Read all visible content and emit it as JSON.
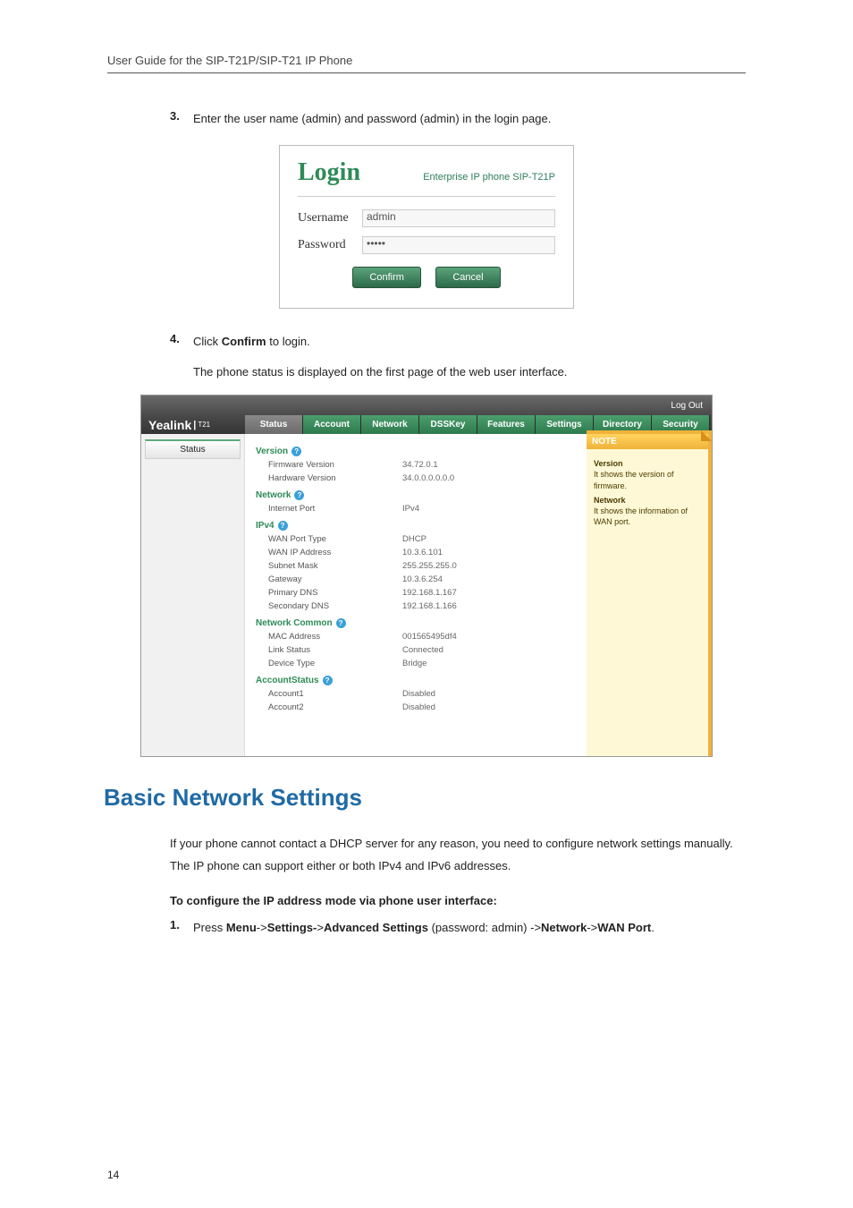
{
  "guide_title": "User Guide for the SIP-T21P/SIP-T21 IP Phone",
  "step3": {
    "num": "3.",
    "text": "Enter the user name (admin) and password (admin) in the login page."
  },
  "login": {
    "title": "Login",
    "subtitle": "Enterprise IP phone SIP-T21P",
    "username_label": "Username",
    "username_value": "admin",
    "password_label": "Password",
    "password_value": "•••••",
    "confirm": "Confirm",
    "cancel": "Cancel"
  },
  "step4": {
    "num": "4.",
    "prefix": "Click ",
    "bold": "Confirm",
    "suffix": " to login."
  },
  "step4_sub": "The phone status is displayed on the first page of the web user interface.",
  "webui": {
    "logout": "Log Out",
    "logo": "Yealink",
    "logo_sub": "T21",
    "tabs": [
      "Status",
      "Account",
      "Network",
      "DSSKey",
      "Features",
      "Settings",
      "Directory",
      "Security"
    ],
    "side": "Status",
    "sections": {
      "version": {
        "title": "Version",
        "rows": [
          {
            "k": "Firmware Version",
            "v": "34.72.0.1"
          },
          {
            "k": "Hardware Version",
            "v": "34.0.0.0.0.0.0"
          }
        ]
      },
      "network": {
        "title": "Network",
        "rows": [
          {
            "k": "Internet Port",
            "v": "IPv4"
          }
        ]
      },
      "ipv4": {
        "title": "IPv4",
        "rows": [
          {
            "k": "WAN Port Type",
            "v": "DHCP"
          },
          {
            "k": "WAN IP Address",
            "v": "10.3.6.101"
          },
          {
            "k": "Subnet Mask",
            "v": "255.255.255.0"
          },
          {
            "k": "Gateway",
            "v": "10.3.6.254"
          },
          {
            "k": "Primary DNS",
            "v": "192.168.1.167"
          },
          {
            "k": "Secondary DNS",
            "v": "192.168.1.166"
          }
        ]
      },
      "common": {
        "title": "Network Common",
        "rows": [
          {
            "k": "MAC Address",
            "v": "001565495df4"
          },
          {
            "k": "Link Status",
            "v": "Connected"
          },
          {
            "k": "Device Type",
            "v": "Bridge"
          }
        ]
      },
      "account": {
        "title": "AccountStatus",
        "rows": [
          {
            "k": "Account1",
            "v": "Disabled"
          },
          {
            "k": "Account2",
            "v": "Disabled"
          }
        ]
      }
    },
    "note": {
      "title": "NOTE",
      "v_title": "Version",
      "v_body": "It shows the version of firmware.",
      "n_title": "Network",
      "n_body": "It shows the information of WAN port."
    }
  },
  "section_title": "Basic Network Settings",
  "para1": "If your phone cannot contact a DHCP server for any reason, you need to configure network settings manually. The IP phone can support either or both IPv4 and IPv6 addresses.",
  "bold_line": "To configure the IP address mode via phone user interface:",
  "step_nw": {
    "num": "1.",
    "p1": "Press ",
    "b1": "Menu",
    "a1": "->",
    "b2": "Settings-",
    "a2": ">",
    "b3": "Advanced Settings",
    "mid": " (password: admin) ->",
    "b4": "Network",
    "a4": "->",
    "b5": "WAN Port",
    "end": "."
  },
  "page_num": "14"
}
